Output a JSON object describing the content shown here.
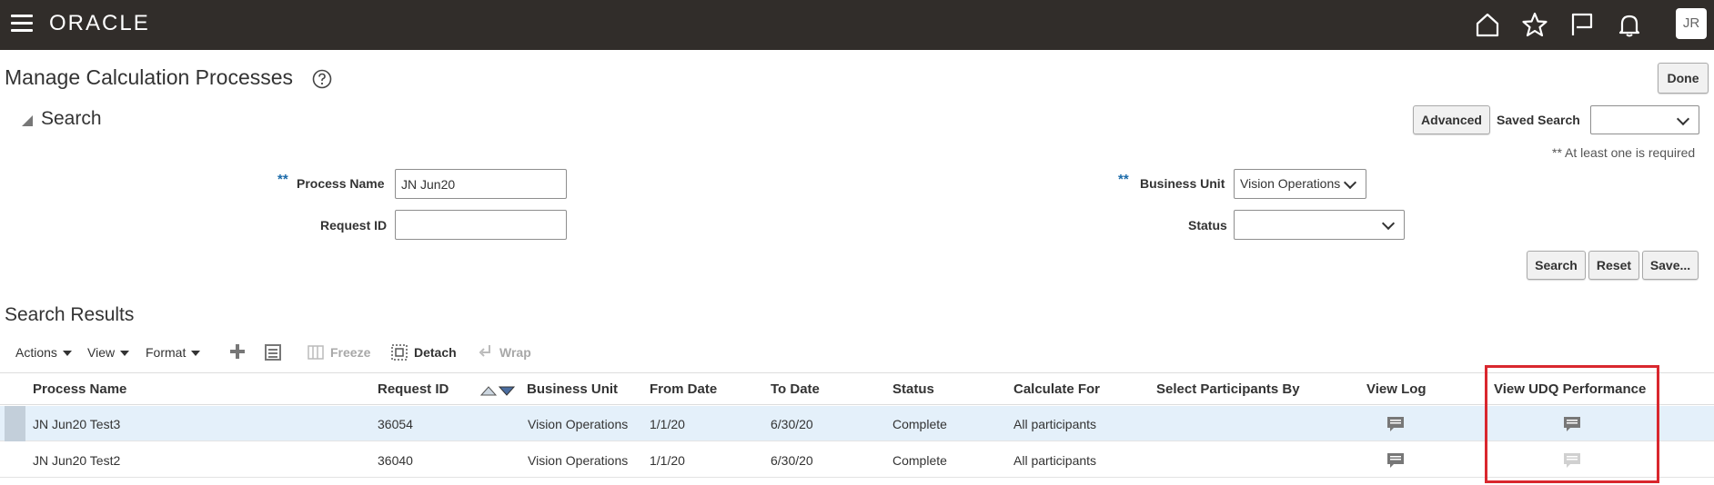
{
  "header": {
    "logo": "ORACLE",
    "icons": [
      "home-icon",
      "star-icon",
      "flag-icon",
      "bell-icon"
    ],
    "user_initials": "JR"
  },
  "page": {
    "title": "Manage Calculation Processes",
    "done_label": "Done"
  },
  "search": {
    "title": "Search",
    "advanced_label": "Advanced",
    "saved_search_label": "Saved Search",
    "saved_search_value": "",
    "required_note": "** At least one is required",
    "required_marker": "**",
    "process_name_label": "Process Name",
    "process_name_value": "JN Jun20",
    "request_id_label": "Request ID",
    "request_id_value": "",
    "business_unit_label": "Business Unit",
    "business_unit_value": "Vision Operations",
    "status_label": "Status",
    "status_value": "",
    "search_button": "Search",
    "reset_button": "Reset",
    "save_button": "Save..."
  },
  "results": {
    "title": "Search Results",
    "toolbar": {
      "actions": "Actions",
      "view": "View",
      "format": "Format",
      "freeze": "Freeze",
      "detach": "Detach",
      "wrap": "Wrap"
    },
    "columns": [
      "Process Name",
      "Request ID",
      "Business Unit",
      "From Date",
      "To Date",
      "Status",
      "Calculate For",
      "Select Participants By",
      "View Log",
      "View UDQ Performance"
    ],
    "rows": [
      {
        "process_name": "JN Jun20 Test3",
        "request_id": "36054",
        "business_unit": "Vision Operations",
        "from_date": "1/1/20",
        "to_date": "6/30/20",
        "status": "Complete",
        "calculate_for": "All participants",
        "select_participants_by": ""
      },
      {
        "process_name": "JN Jun20 Test2",
        "request_id": "36040",
        "business_unit": "Vision Operations",
        "from_date": "1/1/20",
        "to_date": "6/30/20",
        "status": "Complete",
        "calculate_for": "All participants",
        "select_participants_by": ""
      }
    ]
  },
  "colors": {
    "header_bg": "#312d2a",
    "selected_row": "#e4f0fa",
    "highlight_border": "#d9272e",
    "required_marker": "#1c6ba9"
  }
}
